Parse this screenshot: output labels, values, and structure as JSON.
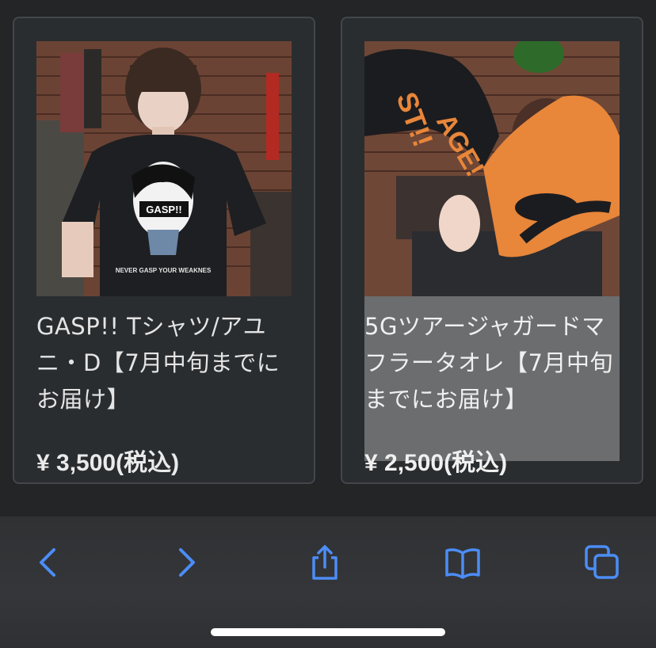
{
  "products": [
    {
      "title": "GASP!! Tシャツ/アユニ・D【7月中旬までにお届け】",
      "price": "¥ 3,500(税込)",
      "shirt_text": "GASP!!",
      "shirt_slogan": "NEVER GASP YOUR WEAKNES"
    },
    {
      "title": "5Gツアージャガードマフラータオレ【7月中旬までにお届け】",
      "price": "¥ 2,500(税込)",
      "towel_text_1": "ST!!",
      "towel_text_2": "AGE!"
    }
  ],
  "toolbar": {
    "back_icon": "chevron-left-icon",
    "forward_icon": "chevron-right-icon",
    "share_icon": "share-icon",
    "bookmarks_icon": "book-icon",
    "tabs_icon": "tabs-icon"
  },
  "colors": {
    "accent": "#4c8df6",
    "background": "#232527",
    "card": "#2a2d30",
    "highlight": "#6b6d6e"
  }
}
